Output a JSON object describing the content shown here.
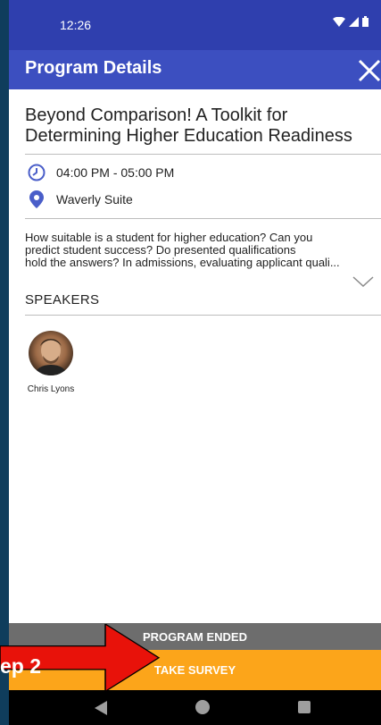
{
  "status_bar": {
    "time": "12:26"
  },
  "app_bar": {
    "title": "Program Details",
    "close_icon": "close-icon"
  },
  "program": {
    "title_line1": "Beyond Comparison! A Toolkit for",
    "title_line2": "Determining Higher Education Readiness",
    "time": "04:00 PM - 05:00 PM",
    "location": "Waverly Suite",
    "description_lines": [
      "How suitable is a student for higher education? Can you",
      "predict student success? Do presented qualifications",
      "hold the answers? In admissions, evaluating applicant quali..."
    ]
  },
  "speakers": {
    "heading": "SPEAKERS",
    "items": [
      {
        "name": "Chris Lyons"
      }
    ]
  },
  "footer": {
    "ended_label": "PROGRAM ENDED",
    "survey_label": "TAKE SURVEY"
  },
  "annotation": {
    "label": "ep 2",
    "color": "#e8120a"
  },
  "colors": {
    "status_bar": "#2f3fae",
    "app_bar": "#3c4fc0",
    "accent_icon": "#4a5ec9",
    "ended_bar": "#6d6d6d",
    "survey_bar": "#fca51a"
  }
}
